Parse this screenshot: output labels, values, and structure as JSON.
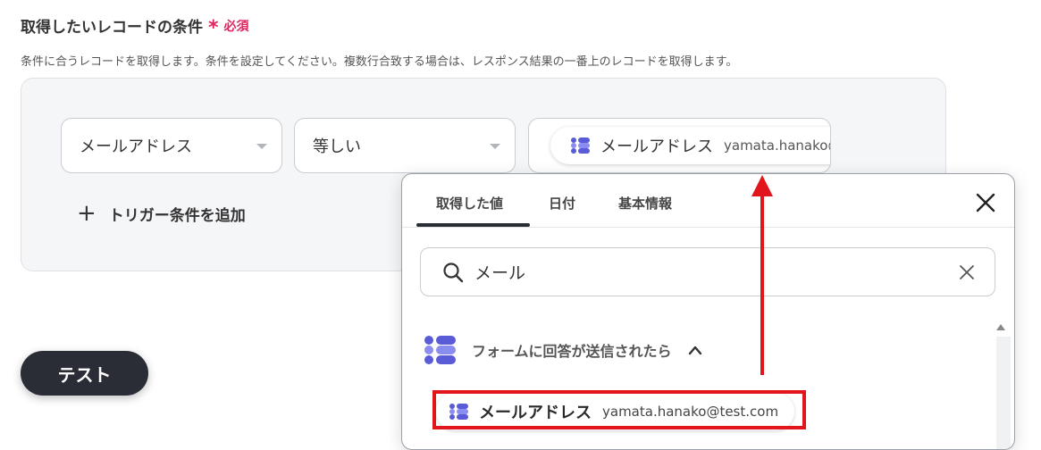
{
  "header": {
    "title": "取得したいレコードの条件",
    "required_mark": "*",
    "required_label": "必須",
    "description": "条件に合うレコードを取得します。条件を設定してください。複数行合致する場合は、レスポンス結果の一番上のレコードを取得します。"
  },
  "condition": {
    "field_select": "メールアドレス",
    "operator_select": "等しい",
    "value_chip_label": "メールアドレス",
    "value_chip_value": "yamata.hanako@test.com"
  },
  "add_trigger_label": "トリガー条件を追加",
  "test_button_label": "テスト",
  "popup": {
    "tabs": [
      {
        "label": "取得した値",
        "active": true
      },
      {
        "label": "日付",
        "active": false
      },
      {
        "label": "基本情報",
        "active": false
      }
    ],
    "search_value": "メール",
    "group_label": "フォームに回答が送信されたら",
    "item_label": "メールアドレス",
    "item_value": "yamata.hanako@test.com"
  },
  "colors": {
    "accent_red": "#e0161c",
    "required_pink": "#e0245e",
    "icon_purple": "#5a5bd6",
    "dark_button": "#2a2d35"
  }
}
